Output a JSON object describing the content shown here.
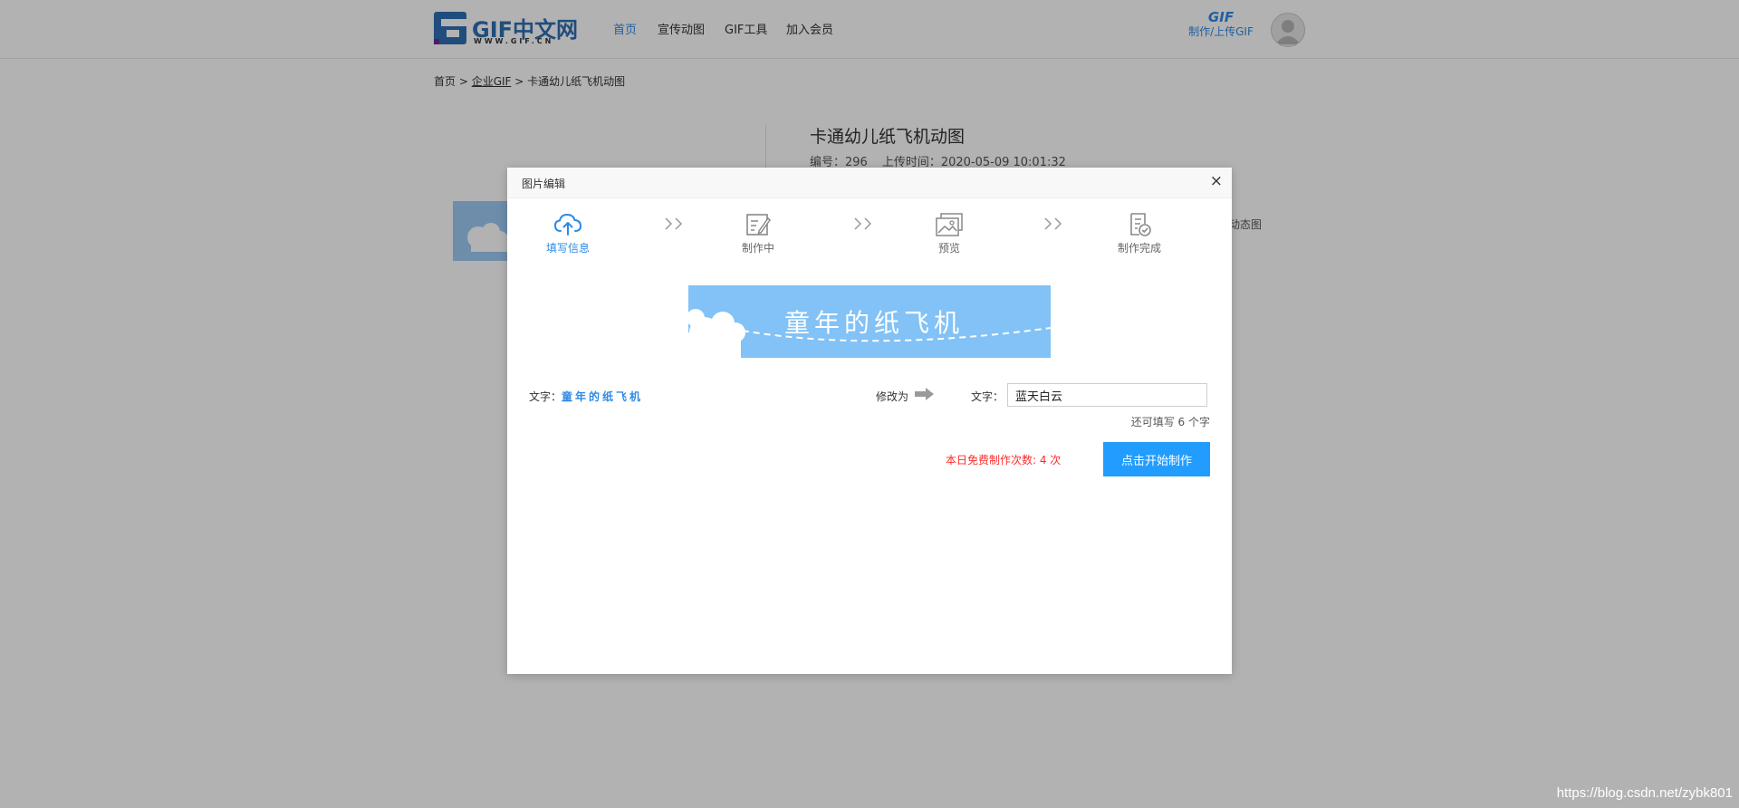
{
  "header": {
    "logo_text": "GIF中文网",
    "logo_sub": "WWW.GIF.CN",
    "nav": [
      "首页",
      "宣传动图",
      "GIF工具",
      "加入会员"
    ],
    "make_gif": "GIF",
    "make_upload": "制作/上传GIF",
    "accent_color": "#2e8ae6"
  },
  "breadcrumb": {
    "home": "首页",
    "sep1": " > ",
    "category": "企业GIF",
    "sep2": " > ",
    "current": "卡通幼儿纸飞机动图"
  },
  "detail": {
    "title": "卡通幼儿纸飞机动图",
    "id_text": "编号：296",
    "upload_time": "上传时间：2020-05-09 10:01:32",
    "side_text": "动态图"
  },
  "modal": {
    "title": "图片编辑",
    "close": "×",
    "steps": [
      {
        "label": "填写信息",
        "icon": "cloud-upload-icon",
        "active": true
      },
      {
        "label": "制作中",
        "icon": "edit-document-icon",
        "active": false
      },
      {
        "label": "预览",
        "icon": "image-preview-icon",
        "active": false
      },
      {
        "label": "制作完成",
        "icon": "document-check-icon",
        "active": false
      }
    ],
    "preview_text": "童年的纸飞机",
    "original_label": "文字：",
    "original_value": "童年的纸飞机",
    "modify_label": "修改为",
    "field_label": "文字：",
    "input_value": "蓝天白云",
    "remaining": "还可填写 6 个字",
    "free_count": "本日免费制作次数: 4 次",
    "start_button": "点击开始制作"
  },
  "watermark": "https://blog.csdn.net/zybk801"
}
